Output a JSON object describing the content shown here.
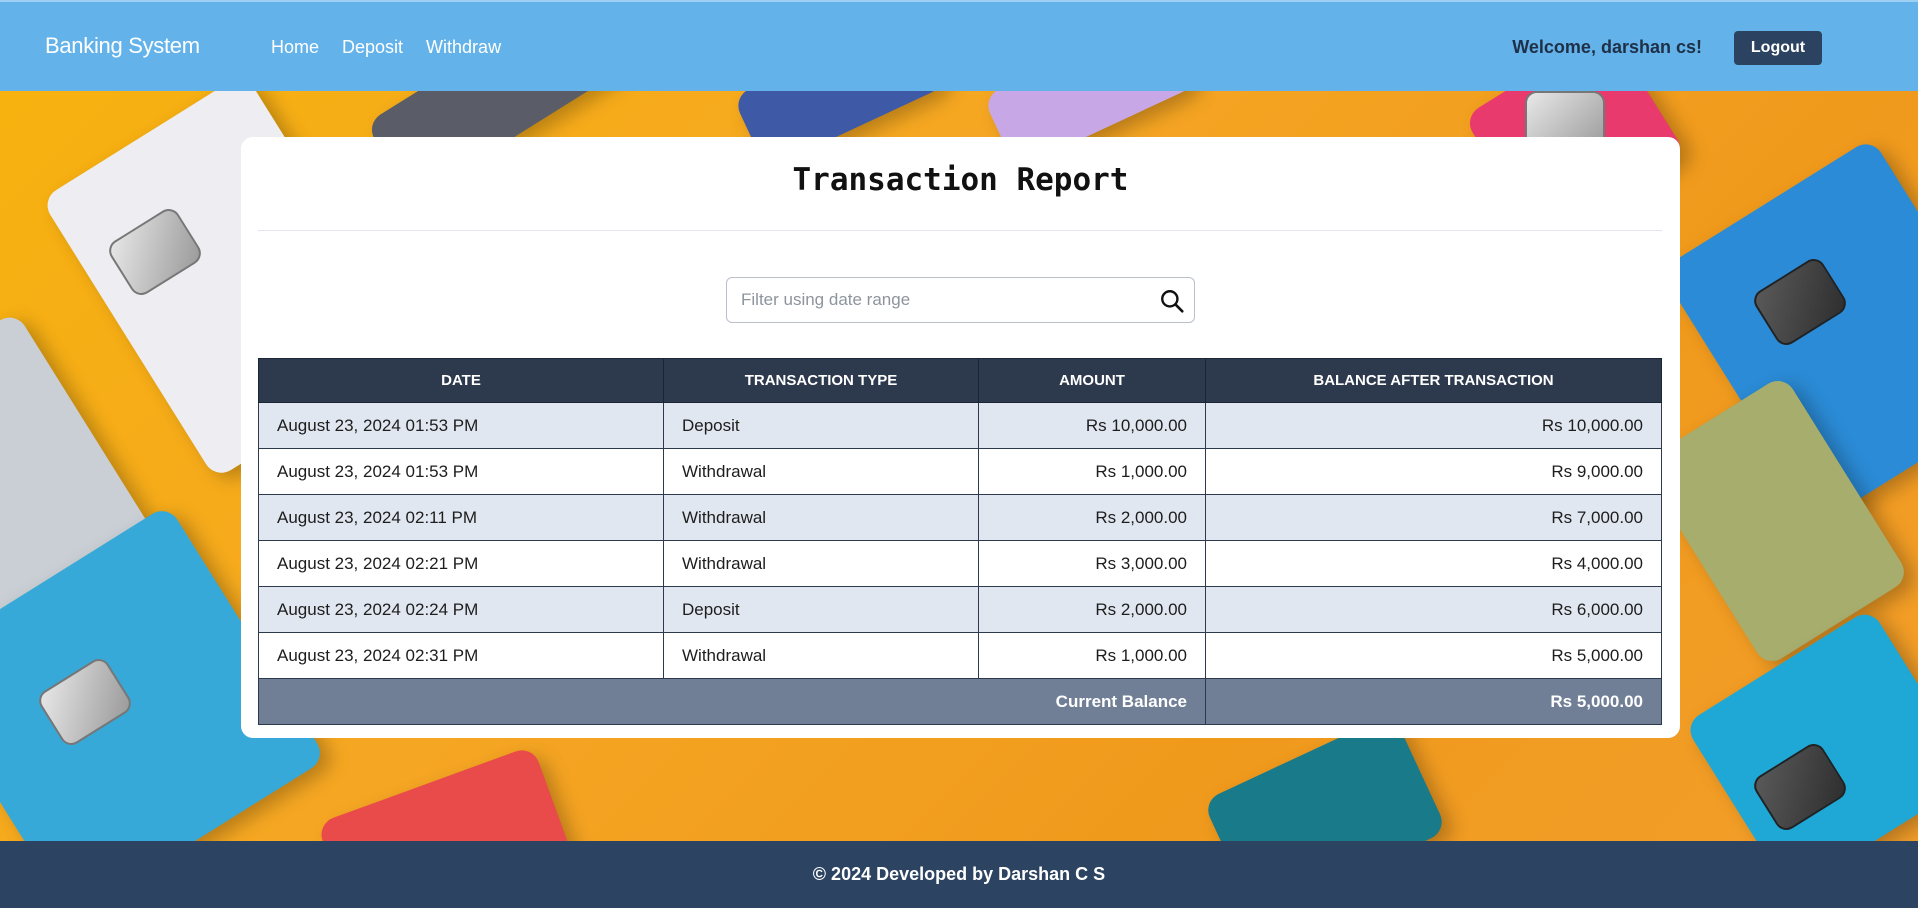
{
  "navbar": {
    "brand": "Banking System",
    "links": [
      "Home",
      "Deposit",
      "Withdraw"
    ],
    "welcome": "Welcome, darshan cs!",
    "logout_label": "Logout"
  },
  "report": {
    "title": "Transaction Report",
    "filter_placeholder": "Filter using date range",
    "columns": [
      "DATE",
      "TRANSACTION TYPE",
      "AMOUNT",
      "BALANCE AFTER TRANSACTION"
    ],
    "rows": [
      {
        "date": "August 23, 2024 01:53 PM",
        "type": "Deposit",
        "amount": "Rs 10,000.00",
        "balance": "Rs 10,000.00"
      },
      {
        "date": "August 23, 2024 01:53 PM",
        "type": "Withdrawal",
        "amount": "Rs 1,000.00",
        "balance": "Rs 9,000.00"
      },
      {
        "date": "August 23, 2024 02:11 PM",
        "type": "Withdrawal",
        "amount": "Rs 2,000.00",
        "balance": "Rs 7,000.00"
      },
      {
        "date": "August 23, 2024 02:21 PM",
        "type": "Withdrawal",
        "amount": "Rs 3,000.00",
        "balance": "Rs 4,000.00"
      },
      {
        "date": "August 23, 2024 02:24 PM",
        "type": "Deposit",
        "amount": "Rs 2,000.00",
        "balance": "Rs 6,000.00"
      },
      {
        "date": "August 23, 2024 02:31 PM",
        "type": "Withdrawal",
        "amount": "Rs 1,000.00",
        "balance": "Rs 5,000.00"
      }
    ],
    "total_label": "Current Balance",
    "total_value": "Rs 5,000.00"
  },
  "footer": {
    "text": "© 2024 Developed by Darshan C S"
  },
  "colors": {
    "navbar": "#63b3ea",
    "table_header": "#2d3a4d",
    "total_row": "#717f96",
    "footer": "#2c4361"
  }
}
